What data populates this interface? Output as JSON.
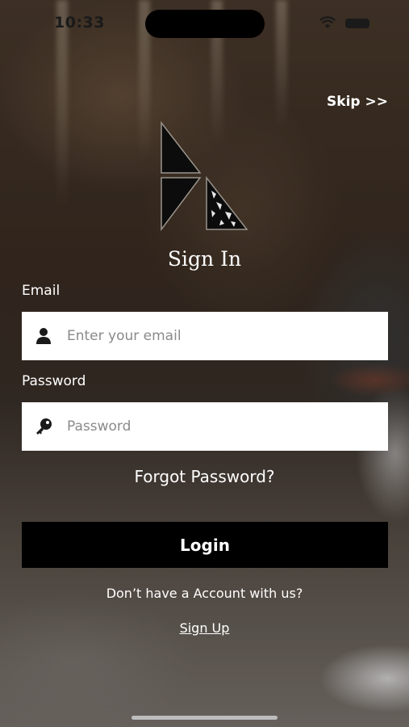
{
  "status_bar": {
    "time": "10:33"
  },
  "header": {
    "skip_label": "Skip >>"
  },
  "logo": {
    "icon": "brand-logo-icon"
  },
  "page": {
    "title": "Sign In"
  },
  "form": {
    "email": {
      "label": "Email",
      "placeholder": "Enter your email",
      "value": "",
      "icon": "user-icon"
    },
    "password": {
      "label": "Password",
      "placeholder": "Password",
      "value": "",
      "icon": "key-icon"
    },
    "forgot_label": "Forgot Password?",
    "login_label": "Login"
  },
  "footer": {
    "prompt": "Don’t have a Account with us?",
    "signup_label": "Sign Up"
  },
  "colors": {
    "button_bg": "#000000",
    "input_bg": "#ffffff",
    "text": "#ffffff"
  }
}
